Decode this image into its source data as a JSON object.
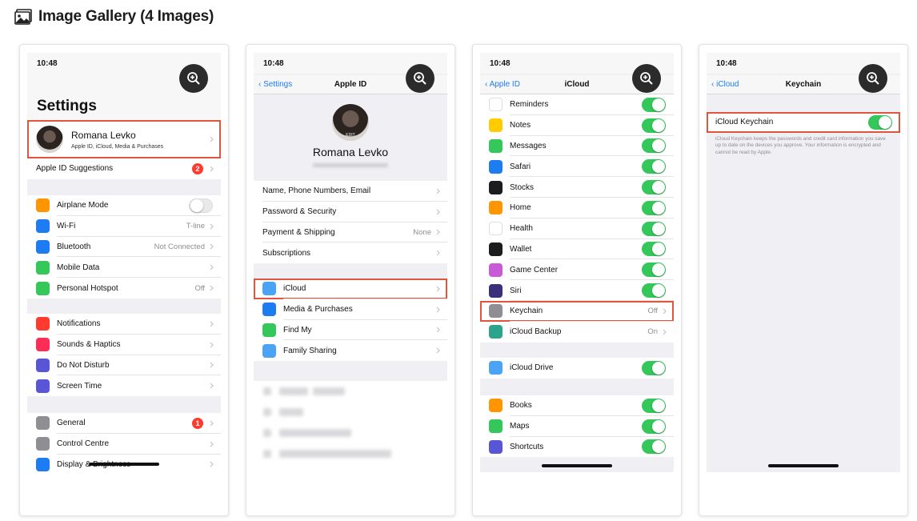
{
  "gallery": {
    "title": "Image Gallery (4 Images)"
  },
  "colors": {
    "accent": "#1e7cf2",
    "toggle_on": "#34c759",
    "highlight": "#e0553b",
    "badge": "#ff3b30"
  },
  "screens": [
    {
      "time": "10:48",
      "large_title": "Settings",
      "profile": {
        "name": "Romana Levko",
        "subtitle": "Apple ID, iCloud, Media & Purchases"
      },
      "suggestions": {
        "label": "Apple ID Suggestions",
        "badge": "2"
      },
      "group1": [
        {
          "label": "Airplane Mode",
          "icon": "airplane-icon",
          "color": "#ff9500",
          "toggle": "off"
        },
        {
          "label": "Wi-Fi",
          "icon": "wifi-icon",
          "color": "#1e7cf2",
          "value": "T-line"
        },
        {
          "label": "Bluetooth",
          "icon": "bluetooth-icon",
          "color": "#1e7cf2",
          "value": "Not Connected"
        },
        {
          "label": "Mobile Data",
          "icon": "antenna-icon",
          "color": "#34c759",
          "value": ""
        },
        {
          "label": "Personal Hotspot",
          "icon": "hotspot-icon",
          "color": "#34c759",
          "value": "Off"
        }
      ],
      "group2": [
        {
          "label": "Notifications",
          "icon": "notifications-icon",
          "color": "#ff3b30"
        },
        {
          "label": "Sounds & Haptics",
          "icon": "speaker-icon",
          "color": "#ff2d55"
        },
        {
          "label": "Do Not Disturb",
          "icon": "moon-icon",
          "color": "#5856d6"
        },
        {
          "label": "Screen Time",
          "icon": "hourglass-icon",
          "color": "#5856d6"
        }
      ],
      "group3": [
        {
          "label": "General",
          "icon": "gear-icon",
          "color": "#8e8e93",
          "badge": "1"
        },
        {
          "label": "Control Centre",
          "icon": "switches-icon",
          "color": "#8e8e93"
        },
        {
          "label": "Display & Brightness",
          "icon": "display-icon",
          "color": "#1e7cf2"
        }
      ]
    },
    {
      "time": "10:48",
      "back": "Settings",
      "title": "Apple ID",
      "profile_name": "Romana Levko",
      "avatar_badge": "EDIT",
      "group1": [
        {
          "label": "Name, Phone Numbers, Email",
          "value": ""
        },
        {
          "label": "Password & Security",
          "value": ""
        },
        {
          "label": "Payment & Shipping",
          "value": "None"
        },
        {
          "label": "Subscriptions",
          "value": ""
        }
      ],
      "group2": [
        {
          "label": "iCloud",
          "icon": "cloud-icon",
          "color": "#4aa3f5"
        },
        {
          "label": "Media & Purchases",
          "icon": "app-store-icon",
          "color": "#1e7cf2"
        },
        {
          "label": "Find My",
          "icon": "find-my-icon",
          "color": "#34c759"
        },
        {
          "label": "Family Sharing",
          "icon": "family-icon",
          "color": "#4aa3f5"
        }
      ]
    },
    {
      "time": "10:48",
      "back": "Apple ID",
      "title": "iCloud",
      "group1": [
        {
          "label": "Reminders",
          "icon": "reminders-icon",
          "color": "#ffffff",
          "toggle": "on"
        },
        {
          "label": "Notes",
          "icon": "notes-icon",
          "color": "#ffcc00",
          "toggle": "on"
        },
        {
          "label": "Messages",
          "icon": "messages-icon",
          "color": "#34c759",
          "toggle": "on"
        },
        {
          "label": "Safari",
          "icon": "compass-icon",
          "color": "#1e7cf2",
          "toggle": "on"
        },
        {
          "label": "Stocks",
          "icon": "stocks-icon",
          "color": "#1c1c1e",
          "toggle": "on"
        },
        {
          "label": "Home",
          "icon": "home-icon",
          "color": "#ff9500",
          "toggle": "on"
        },
        {
          "label": "Health",
          "icon": "heart-icon",
          "color": "#ffffff",
          "toggle": "on"
        },
        {
          "label": "Wallet",
          "icon": "wallet-icon",
          "color": "#1c1c1e",
          "toggle": "on"
        },
        {
          "label": "Game Center",
          "icon": "game-center-icon",
          "color": "#c85ad8",
          "toggle": "on"
        },
        {
          "label": "Siri",
          "icon": "siri-icon",
          "color": "#3a2f7a",
          "toggle": "on"
        },
        {
          "label": "Keychain",
          "icon": "key-icon",
          "color": "#8e8e93",
          "value": "Off"
        },
        {
          "label": "iCloud Backup",
          "icon": "backup-icon",
          "color": "#2ca38b",
          "value": "On"
        }
      ],
      "group2": [
        {
          "label": "iCloud Drive",
          "icon": "cloud-icon",
          "color": "#4aa3f5",
          "toggle": "on"
        }
      ],
      "group3": [
        {
          "label": "Books",
          "icon": "books-icon",
          "color": "#ff9500",
          "toggle": "on"
        },
        {
          "label": "Maps",
          "icon": "maps-icon",
          "color": "#34c759",
          "toggle": "on"
        },
        {
          "label": "Shortcuts",
          "icon": "shortcuts-icon",
          "color": "#5856d6",
          "toggle": "on"
        }
      ]
    },
    {
      "time": "10:48",
      "back": "iCloud",
      "title": "Keychain",
      "toggle_label": "iCloud Keychain",
      "description": "iCloud Keychain keeps the passwords and credit card information you save up to date on the devices you approve. Your information is encrypted and cannot be read by Apple."
    }
  ]
}
